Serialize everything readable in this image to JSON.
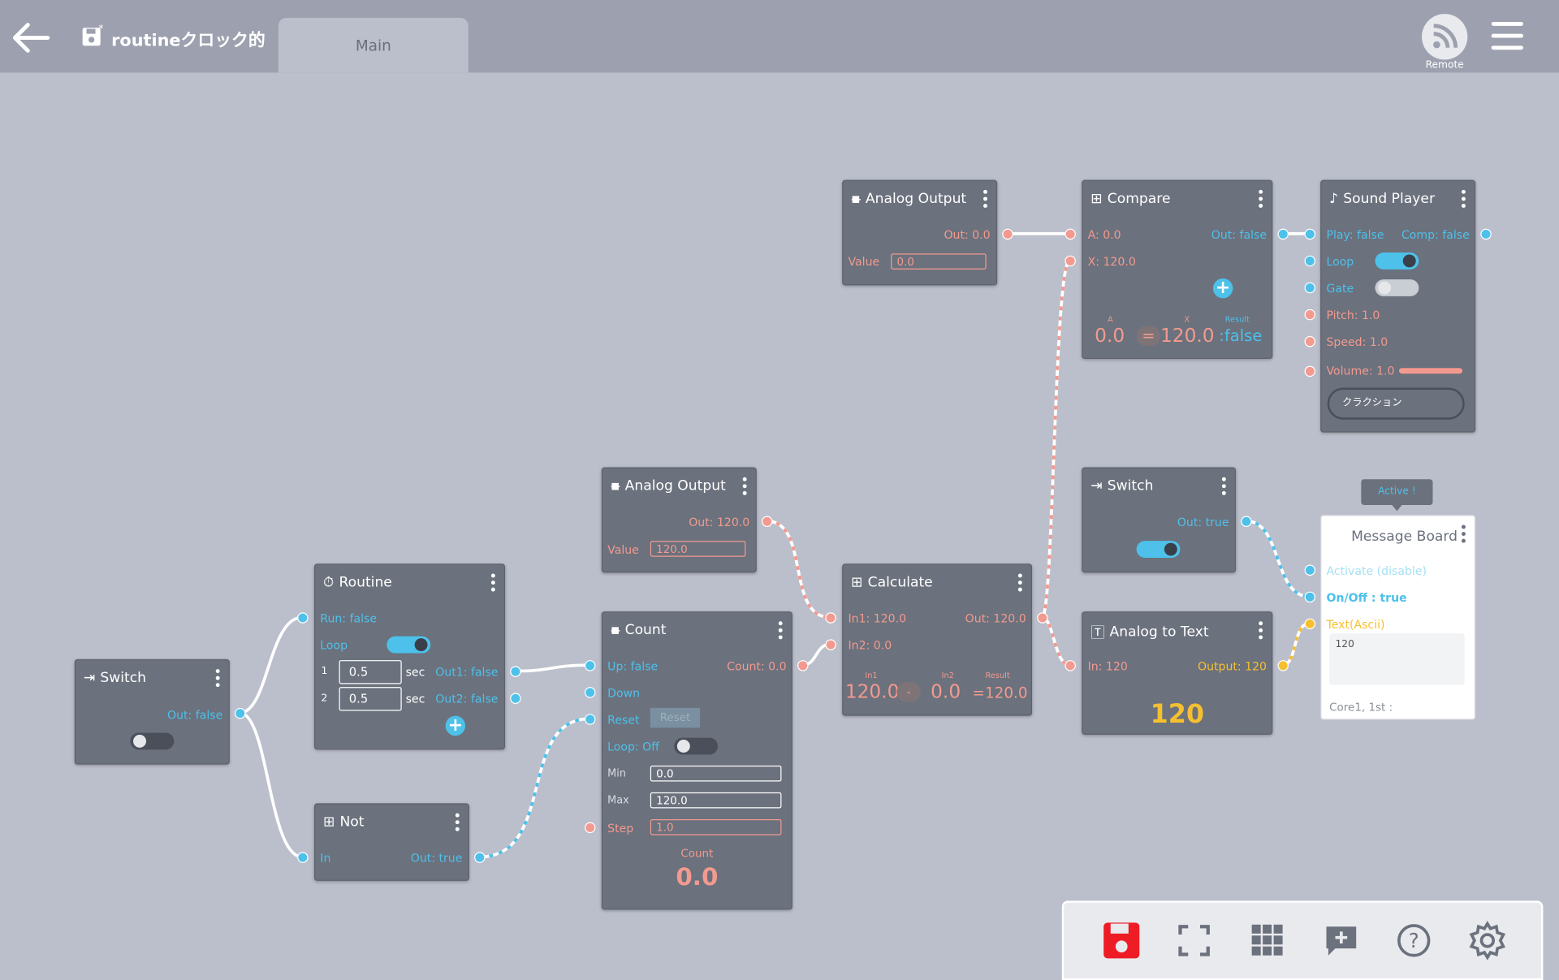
{
  "header": {
    "title": "routineクロック的",
    "tab": "Main",
    "remote_label": "Remote"
  },
  "nodes": {
    "switch1": {
      "title": "Switch",
      "out": "Out: false",
      "toggle": false
    },
    "routine": {
      "title": "Routine",
      "run": "Run: false",
      "loop": "Loop",
      "row1_idx": "1",
      "row1_val": "0.5",
      "row1_unit": "sec",
      "row1_out": "Out1: false",
      "row2_idx": "2",
      "row2_val": "0.5",
      "row2_unit": "sec",
      "row2_out": "Out2: false"
    },
    "not": {
      "title": "Not",
      "in": "In",
      "out": "Out: true"
    },
    "analog1": {
      "title": "Analog Output",
      "out": "Out: 120.0",
      "value_label": "Value",
      "value": "120.0"
    },
    "count": {
      "title": "Count",
      "up": "Up: false",
      "count_out": "Count: 0.0",
      "down": "Down",
      "reset": "Reset",
      "reset_btn": "Reset",
      "loop": "Loop: Off",
      "min_label": "Min",
      "min": "0.0",
      "max_label": "Max",
      "max": "120.0",
      "step_label": "Step",
      "step": "1.0",
      "display_label": "Count",
      "display": "0.0"
    },
    "calculate": {
      "title": "Calculate",
      "in1": "In1: 120.0",
      "in2": "In2: 0.0",
      "out": "Out: 120.0",
      "in1_lbl": "In1",
      "in1_val": "120.0",
      "op": "-",
      "in2_lbl": "In2",
      "in2_val": "0.0",
      "res_lbl": "Result",
      "res_val": "=120.0"
    },
    "analog2": {
      "title": "Analog Output",
      "out": "Out: 0.0",
      "value_label": "Value",
      "value": "0.0"
    },
    "compare": {
      "title": "Compare",
      "a": "A: 0.0",
      "x": "X: 120.0",
      "out": "Out: false",
      "a_lbl": "A",
      "a_val": "0.0",
      "op": "=",
      "x_lbl": "X",
      "x_val": "120.0",
      "res_lbl": "Result",
      "res_val": ":false"
    },
    "switch2": {
      "title": "Switch",
      "out": "Out: true",
      "toggle": true
    },
    "a2t": {
      "title": "Analog to Text",
      "in": "In: 120",
      "out": "Output: 120",
      "display": "120"
    },
    "sound": {
      "title": "Sound Player",
      "play": "Play: false",
      "comp": "Comp: false",
      "loop": "Loop",
      "gate": "Gate",
      "pitch": "Pitch: 1.0",
      "speed": "Speed: 1.0",
      "volume": "Volume: 1.0",
      "volume_level": 1.0,
      "button": "クラクション"
    },
    "board": {
      "title": "Message Board",
      "bubble": "Active !",
      "activate": "Activate (disable)",
      "onoff": "On/Off : true",
      "text": "Text(Ascii)",
      "content": "120",
      "footer": "Core1, 1st :"
    }
  },
  "colors": {
    "bool": "#4dc1ea",
    "analog": "#f29a8f",
    "text": "#f5c030",
    "save": "#ee1c25"
  },
  "toolbar_icons": [
    "save-icon",
    "fullscreen-icon",
    "grid-icon",
    "add-comment-icon",
    "help-icon",
    "settings-icon"
  ]
}
